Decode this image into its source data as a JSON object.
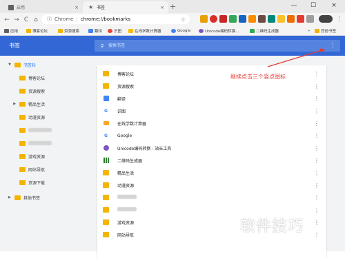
{
  "tabs": [
    {
      "title": "启用",
      "close": "×"
    },
    {
      "title": "书签",
      "close": "×"
    }
  ],
  "new_tab": "+",
  "window": {
    "minimize": "—",
    "maximize": "☐",
    "close": "×"
  },
  "toolbar": {
    "back": "←",
    "forward": "→",
    "reload": "C",
    "home": "⌂"
  },
  "omnibox": {
    "scheme": "Chrome",
    "divider": "|",
    "url": "chrome://bookmarks",
    "star": "☆"
  },
  "bookmarks_bar": {
    "apps": "应用",
    "items": [
      "博客论坛",
      "资源搜索",
      "翻译",
      "识图",
      "在线学数计算器",
      "Google",
      "Unicode编码转换...",
      "二维码生成器"
    ],
    "other": "其他书签",
    "more": "»"
  },
  "header": {
    "title": "书签",
    "search_placeholder": "搜索书签",
    "more": "⋮"
  },
  "sidebar": {
    "root": "书签栏",
    "folders": [
      "博客论坛",
      "资源搜索",
      "精品生活",
      "动漫资源",
      "",
      "",
      "游戏资源",
      "网站导航",
      "资源下载"
    ],
    "other": "其他书签"
  },
  "list": [
    {
      "title": "博客论坛",
      "icon": "folder"
    },
    {
      "title": "资源搜索",
      "icon": "folder"
    },
    {
      "title": "翻译",
      "icon": "translate"
    },
    {
      "title": "识图",
      "icon": "google"
    },
    {
      "title": "在线学数计算器",
      "icon": "calc"
    },
    {
      "title": "Google",
      "icon": "google"
    },
    {
      "title": "Unicode编码转换 - 站长工具",
      "icon": "globe"
    },
    {
      "title": "二维码生成器",
      "icon": "qr"
    },
    {
      "title": "精品生活",
      "icon": "folder"
    },
    {
      "title": "动漫资源",
      "icon": "folder"
    },
    {
      "title": "",
      "icon": "folder"
    },
    {
      "title": "",
      "icon": "folder"
    },
    {
      "title": "游戏资源",
      "icon": "folder"
    },
    {
      "title": "网站导航",
      "icon": "folder"
    }
  ],
  "row_menu": "⋮",
  "annotation": "继续点击三个竖点图标",
  "watermark": "软件技巧",
  "colors": {
    "accent": "#3367d6",
    "folder": "#f4b400",
    "annotation": "#e53935"
  }
}
